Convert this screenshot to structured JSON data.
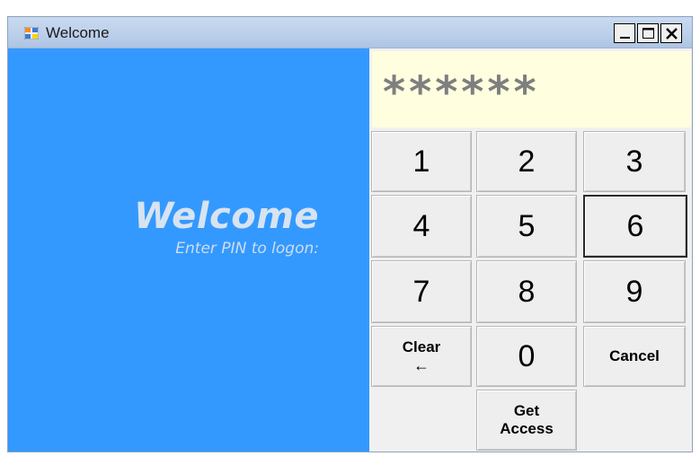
{
  "window": {
    "title": "Welcome"
  },
  "controls": {
    "minimize": "minimize",
    "maximize": "maximize",
    "close": "close"
  },
  "left": {
    "heading": "Welcome",
    "subheading": "Enter PIN to logon:"
  },
  "pin": {
    "masked": "******"
  },
  "keypad": {
    "k1": "1",
    "k2": "2",
    "k3": "3",
    "k4": "4",
    "k5": "5",
    "k6": "6",
    "k7": "7",
    "k8": "8",
    "k9": "9",
    "clear_line1": "Clear",
    "clear_line2": "←",
    "k0": "0",
    "cancel": "Cancel",
    "get_line1": "Get",
    "get_line2": "Access"
  },
  "colors": {
    "panel": "#3399ff",
    "display": "#ffffe0"
  }
}
